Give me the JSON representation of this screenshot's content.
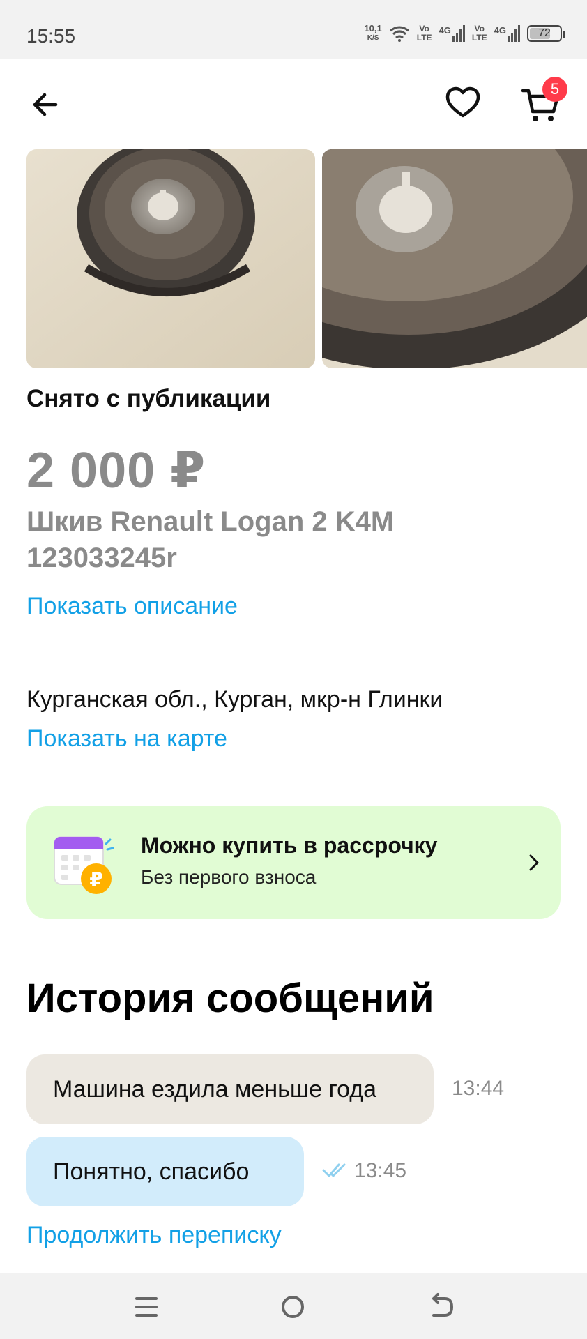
{
  "status_bar": {
    "time": "15:55",
    "speed_value": "10,1",
    "speed_unit": "K/S",
    "net1_top": "Vo",
    "net1_bottom": "LTE",
    "net1_gen": "4G",
    "net2_top": "Vo",
    "net2_bottom": "LTE",
    "net2_gen": "4G",
    "battery": "72"
  },
  "top_bar": {
    "cart_count": "5"
  },
  "gallery": {
    "photo_count_visible": 2
  },
  "listing": {
    "status": "Снято с публикации",
    "price": "2 000 ₽",
    "title": "Шкив Renault Logan 2 K4M 123033245r",
    "show_description": "Показать описание",
    "address": "Курганская обл., Курган, мкр-н Глинки",
    "show_map": "Показать на карте"
  },
  "installment": {
    "title": "Можно купить в рассрочку",
    "subtitle": "Без первого взноса"
  },
  "history": {
    "title": "История сообщений",
    "messages": [
      {
        "text": "Машина ездила меньше года",
        "time": "13:44"
      },
      {
        "text": "Понятно, спасибо",
        "time": "13:45",
        "read": true
      }
    ],
    "continue_label": "Продолжить переписку"
  },
  "colors": {
    "link": "#12a0e6",
    "installment_bg": "#e1fcd4",
    "incoming_bubble": "#ece8e1",
    "outgoing_bubble": "#d2ecfb",
    "badge": "#ff3b4a"
  }
}
